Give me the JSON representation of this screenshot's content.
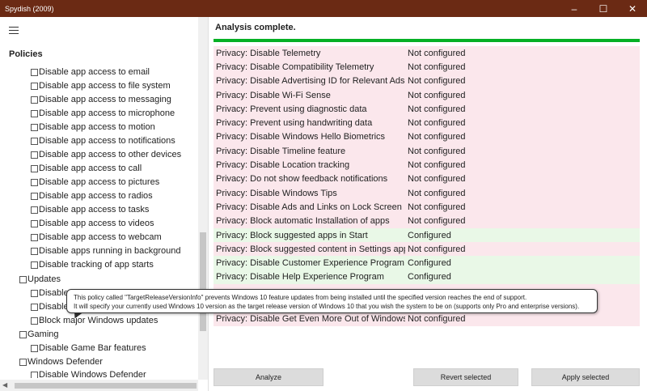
{
  "window": {
    "title": "Spydish (2009)",
    "controls": {
      "minimize": "–",
      "maximize": "☐",
      "close": "✕"
    }
  },
  "sidebar": {
    "title": "Policies",
    "items": [
      {
        "label": "Disable app access to email",
        "level": 2
      },
      {
        "label": "Disable app access to file system",
        "level": 2
      },
      {
        "label": "Disable app access to messaging",
        "level": 2
      },
      {
        "label": "Disable app access to microphone",
        "level": 2
      },
      {
        "label": "Disable app access to motion",
        "level": 2
      },
      {
        "label": "Disable app access to notifications",
        "level": 2
      },
      {
        "label": "Disable app access to other devices",
        "level": 2
      },
      {
        "label": "Disable app access to call",
        "level": 2
      },
      {
        "label": "Disable app access to pictures",
        "level": 2
      },
      {
        "label": "Disable app access to radios",
        "level": 2
      },
      {
        "label": "Disable app access to tasks",
        "level": 2
      },
      {
        "label": "Disable app access to videos",
        "level": 2
      },
      {
        "label": "Disable app access to webcam",
        "level": 2
      },
      {
        "label": "Disable apps running in background",
        "level": 2
      },
      {
        "label": "Disable tracking of app starts",
        "level": 2
      },
      {
        "label": "Updates",
        "level": 1
      },
      {
        "label": "Disable",
        "level": 2
      },
      {
        "label": "Disable",
        "level": 2
      },
      {
        "label": "Block major Windows updates",
        "level": 2
      },
      {
        "label": "Gaming",
        "level": 1
      },
      {
        "label": "Disable Game Bar features",
        "level": 2
      },
      {
        "label": "Windows Defender",
        "level": 1
      },
      {
        "label": "Disable Windows Defender",
        "level": 2
      }
    ]
  },
  "main": {
    "status": "Analysis complete.",
    "progress": 1.0,
    "results": [
      {
        "name": "Privacy: Disable Telemetry",
        "status": "Not configured",
        "state": "bad"
      },
      {
        "name": "Privacy: Disable Compatibility Telemetry",
        "status": "Not configured",
        "state": "bad"
      },
      {
        "name": "Privacy: Disable Advertising ID for Relevant Ads",
        "status": "Not configured",
        "state": "bad"
      },
      {
        "name": "Privacy: Disable Wi-Fi Sense",
        "status": "Not configured",
        "state": "bad"
      },
      {
        "name": "Privacy: Prevent using diagnostic data",
        "status": "Not configured",
        "state": "bad"
      },
      {
        "name": "Privacy: Prevent using handwriting data",
        "status": "Not configured",
        "state": "bad"
      },
      {
        "name": "Privacy: Disable Windows Hello Biometrics",
        "status": "Not configured",
        "state": "bad"
      },
      {
        "name": "Privacy: Disable Timeline feature",
        "status": "Not configured",
        "state": "bad"
      },
      {
        "name": "Privacy: Disable Location tracking",
        "status": "Not configured",
        "state": "bad"
      },
      {
        "name": "Privacy: Do not show feedback notifications",
        "status": "Not configured",
        "state": "bad"
      },
      {
        "name": "Privacy: Disable Windows Tips",
        "status": "Not configured",
        "state": "bad"
      },
      {
        "name": "Privacy: Disable Ads and Links on Lock Screen",
        "status": "Not configured",
        "state": "bad"
      },
      {
        "name": "Privacy: Block automatic Installation of apps",
        "status": "Not configured",
        "state": "bad"
      },
      {
        "name": "Privacy: Block suggested apps in Start",
        "status": "Configured",
        "state": "good"
      },
      {
        "name": "Privacy: Block suggested content in Settings app",
        "status": "Not configured",
        "state": "bad"
      },
      {
        "name": "Privacy: Disable Customer Experience Program",
        "status": "Configured",
        "state": "good"
      },
      {
        "name": "Privacy: Disable Help Experience Program",
        "status": "Configured",
        "state": "good"
      },
      {
        "name": "",
        "status": "",
        "state": "bad"
      },
      {
        "name": "",
        "status": "",
        "state": "bad"
      },
      {
        "name": "Privacy: Disable Get Even More Out of Windows",
        "status": "Not configured",
        "state": "bad"
      }
    ],
    "buttons": {
      "analyze": "Analyze",
      "revert": "Revert selected",
      "apply": "Apply selected"
    }
  },
  "tooltip": {
    "line1": "This policy called \"TargetReleaseVersionInfo\" prevents Windows 10 feature updates from being installed until the specified version reaches the end of support.",
    "line2": "It will specify your currently used Windows 10 version as the target release version of Windows 10 that you wish the system to be on (supports only Pro and enterprise versions)."
  },
  "colors": {
    "titlebar": "#6b2a14",
    "not_configured_bg": "#fbe7ec",
    "configured_bg": "#e9f8e7",
    "progress": "#06b025"
  }
}
